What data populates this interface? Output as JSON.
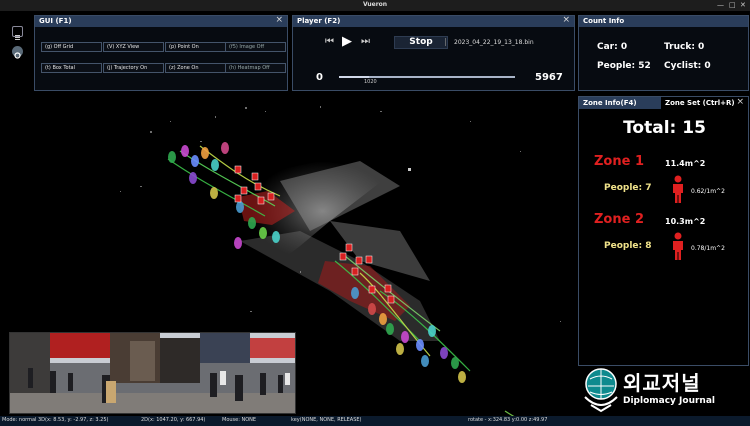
{
  "app": {
    "title": "Vueron"
  },
  "gui_panel": {
    "title": "GUI (F1)",
    "buttons": [
      {
        "label": "(g) Off Grid",
        "active": true
      },
      {
        "label": "(V) XYZ View",
        "active": true
      },
      {
        "label": "(p) Point On",
        "active": true
      },
      {
        "label": "(f5) Image Off",
        "active": false
      },
      {
        "label": "(t) Box Total",
        "active": true
      },
      {
        "label": "(j) Trajectory On",
        "active": true
      },
      {
        "label": "(z) Zone On",
        "active": true
      },
      {
        "label": "(h) Heatmap Off",
        "active": false
      }
    ]
  },
  "player": {
    "title": "Player (F2)",
    "stop_label": "Stop",
    "file_name": "2023_04_22_19_13_18.bin",
    "start_frame": "0",
    "end_frame": "5967",
    "current_frame": "1020",
    "progress_fraction": 0.17
  },
  "count_info": {
    "title": "Count Info",
    "car": "Car: 0",
    "truck": "Truck: 0",
    "people": "People: 52",
    "cyclist": "Cyclist: 0"
  },
  "zone_info": {
    "tab_info": "Zone Info(F4)",
    "tab_set": "Zone Set (Ctrl+R)",
    "total": "Total: 15",
    "zones": [
      {
        "name": "Zone 1",
        "area": "11.4m^2",
        "people": "People: 7",
        "density": "0.62/1m^2"
      },
      {
        "name": "Zone 2",
        "area": "10.3m^2",
        "people": "People: 8",
        "density": "0.78/1m^2"
      }
    ]
  },
  "status_bar": {
    "mode": "Mode: normal 3D(x: 8.53, y: -2.97, z: 3.25)",
    "pos2d": "2D(x: 1047.20, y: 667.94)",
    "mouse": "Mouse: NONE",
    "key": "key(NONE, NONE, RELEASE)",
    "rotate": "rotate - x:324.83 y:0.00 z:49.97"
  },
  "watermark": {
    "korean": "외교저널",
    "english": "Diplomacy Journal"
  },
  "colors": {
    "panel_header": "#2a3d5a",
    "zone_red": "#e02020",
    "people_yellow": "#f0e28a",
    "status_bar": "#0b1a2c"
  },
  "icons": {
    "side_top": "list-icon",
    "side_bottom": "settings-icon",
    "prev": "skip-back-icon",
    "play": "play-icon",
    "next": "skip-forward-icon",
    "person": "person-icon"
  }
}
